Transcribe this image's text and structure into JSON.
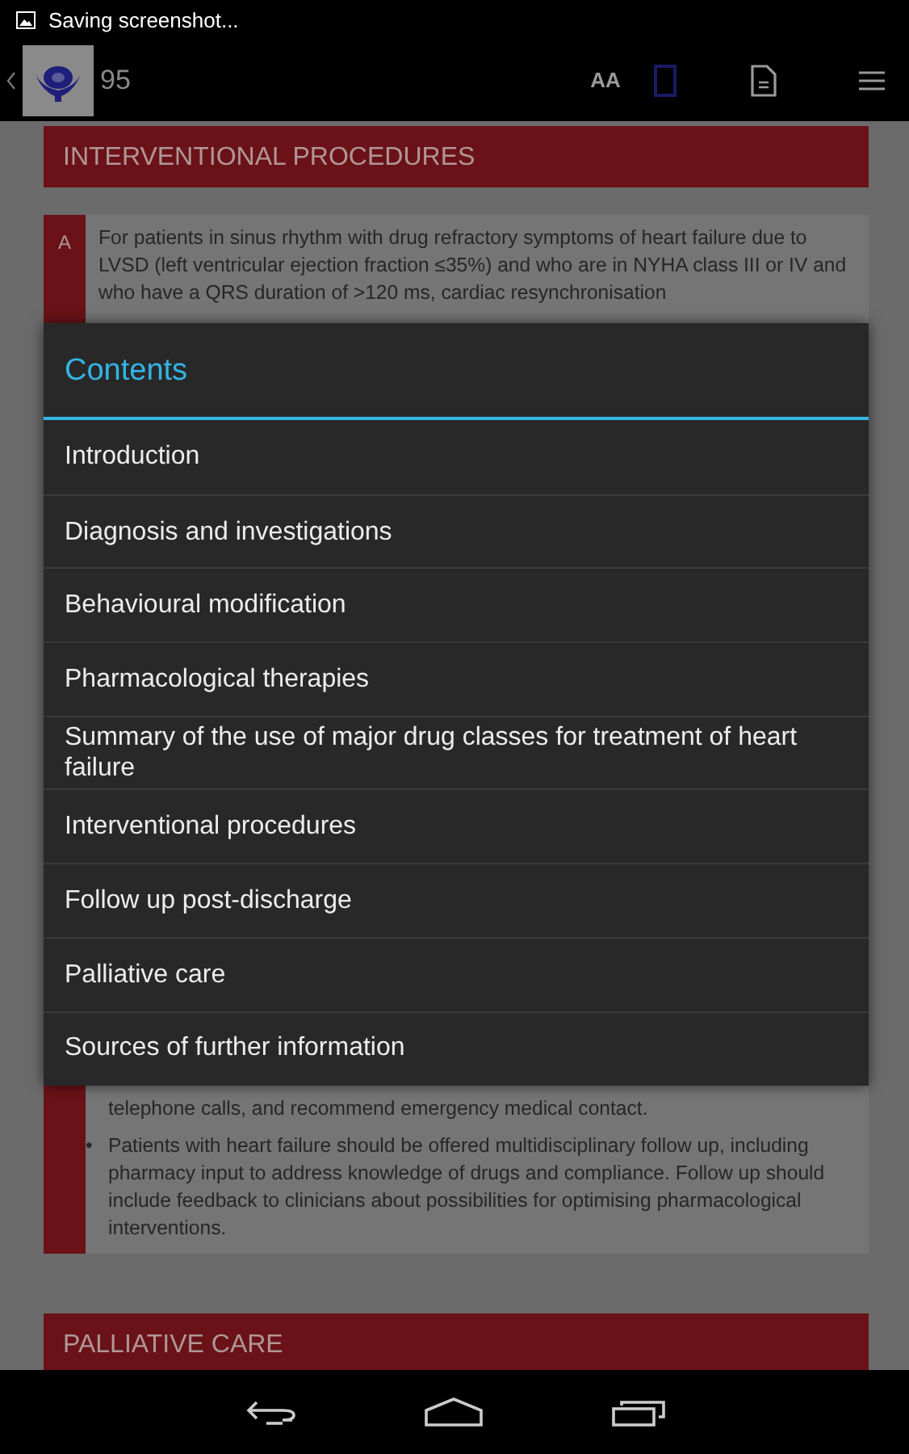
{
  "status_bar": {
    "notification": "Saving screenshot..."
  },
  "action_bar": {
    "page": "95",
    "font_size_button": "AA"
  },
  "content": {
    "heading": "INTERVENTIONAL PROCEDURES",
    "recommendation": {
      "grade": "A",
      "text": "For patients in sinus rhythm with drug refractory symptoms of heart failure due to LVSD (left ventricular ejection fraction ≤35%) and who are in NYHA class III or IV and who have a QRS duration of >120 ms, cardiac resynchronisation"
    },
    "lower_block": [
      {
        "kind": "continuation",
        "text": "telephone calls, and recommend emergency medical contact."
      },
      {
        "kind": "bullet",
        "marker": "•",
        "text": "Patients with heart failure should be offered multidisciplinary follow up, including pharmacy input to address knowledge of drugs and compliance. Follow up should include feedback to clinicians about possibilities for optimising pharmacological interventions."
      }
    ],
    "next_heading": "PALLIATIVE CARE"
  },
  "dialog": {
    "title": "Contents",
    "items": [
      {
        "label": "Introduction"
      },
      {
        "label": "Diagnosis and investigations"
      },
      {
        "label": "Behavioural modification"
      },
      {
        "label": "Pharmacological therapies"
      },
      {
        "label": "Summary of the use of major drug classes for treatment of heart failure"
      },
      {
        "label": "Interventional procedures"
      },
      {
        "label": "Follow up post-discharge"
      },
      {
        "label": "Palliative care"
      },
      {
        "label": "Sources of further information"
      }
    ]
  }
}
